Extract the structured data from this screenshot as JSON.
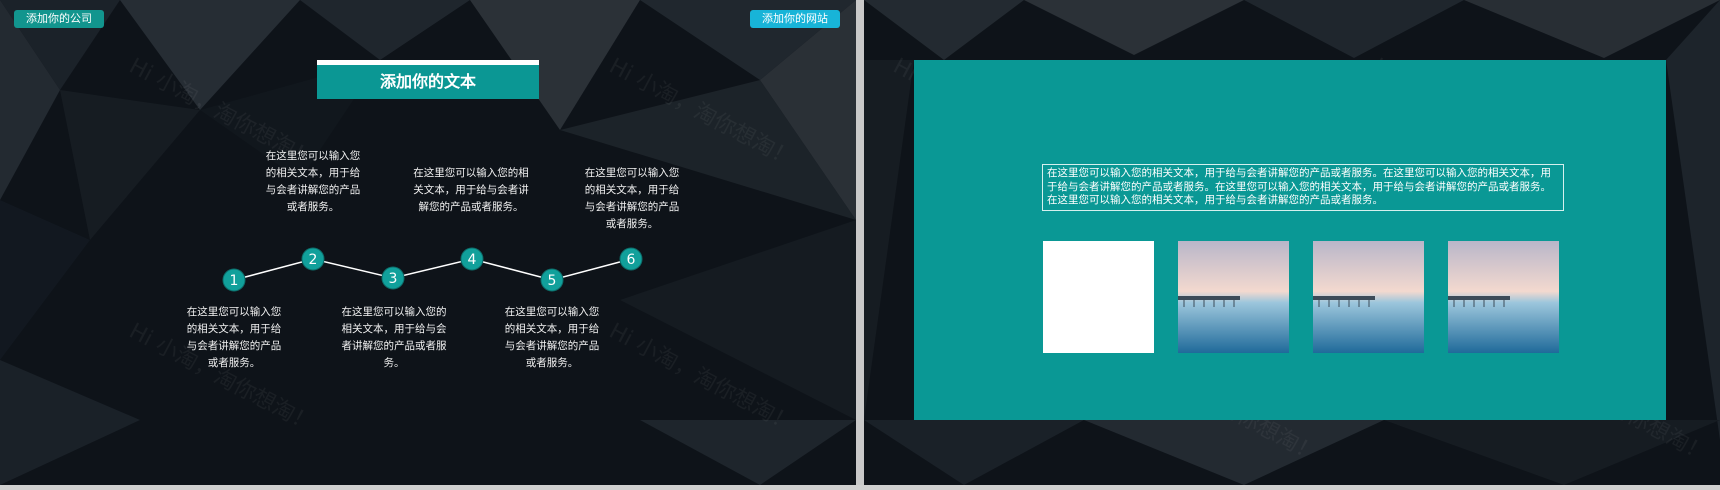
{
  "slide1": {
    "company_label": "添加你的公司",
    "website_label": "添加你的网站",
    "title": "添加你的文本",
    "steps": [
      {
        "number": "1",
        "text": "在这里您可以输入您的相关文本，用于给与会者讲解您的产品或者服务。"
      },
      {
        "number": "2",
        "text": "在这里您可以输入您的相关文本，用于给与会者讲解您的产品或者服务。"
      },
      {
        "number": "3",
        "text": "在这里您可以输入您的相关文本，用于给与会者讲解您的产品或者服务。"
      },
      {
        "number": "4",
        "text": "在这里您可以输入您的相关文本，用于给与会者讲解您的产品或者服务。"
      },
      {
        "number": "5",
        "text": "在这里您可以输入您的相关文本，用于给与会者讲解您的产品或者服务。"
      },
      {
        "number": "6",
        "text": "在这里您可以输入您的相关文本，用于给与会者讲解您的产品或者服务。"
      }
    ],
    "watermark": "Hi 小淘，淘你想淘！"
  },
  "slide2": {
    "body_text": "在这里您可以输入您的相关文本，用于给与会者讲解您的产品或者服务。在这里您可以输入您的相关文本，用于给与会者讲解您的产品或者服务。在这里您可以输入您的相关文本，用于给与会者讲解您的产品或者服务。在这里您可以输入您的相关文本，用于给与会者讲解您的产品或者服务。",
    "watermark": "Hi 小淘，淘你想淘！"
  },
  "colors": {
    "accent": "#0a9895",
    "badge": "#18b4d8",
    "background": "#0e1319"
  }
}
